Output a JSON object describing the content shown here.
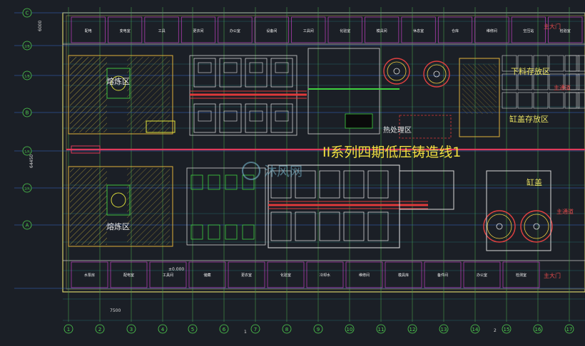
{
  "drawing": {
    "title": "II系列四期低压铸造线1",
    "watermark": "沐风网",
    "zones": {
      "melt_upper": "熔炼区",
      "melt_lower": "熔炼区",
      "heat_treat": "热处理区",
      "lower_material": "下料存放区",
      "cylinder_storage": "缸盖存放区",
      "cylinder_head": "缸盖"
    },
    "doors": {
      "main_top": "主大门",
      "main_bottom": "主大门",
      "main_channel_1": "主通道",
      "main_channel_2": "主通道"
    },
    "columns": [
      "1",
      "2",
      "3",
      "4",
      "5",
      "6",
      "7",
      "8",
      "9",
      "10",
      "11",
      "12",
      "13",
      "14",
      "15",
      "16",
      "17"
    ],
    "rows": [
      "C",
      "2/B",
      "1/B",
      "B",
      "1/A",
      "2/A",
      "A"
    ],
    "dims": {
      "bay": "7500",
      "row_span": "6000",
      "span_b": "64450",
      "elev": "±0.000",
      "col_1_label": "1",
      "col_2_label": "2"
    },
    "top_rooms": [
      "配电",
      "变电室",
      "工具",
      "更衣间",
      "办公室",
      "设备间",
      "工具间",
      "化验室",
      "模具间",
      "休息室",
      "仓库",
      "维修间",
      "空压站",
      "检验室"
    ],
    "bottom_rooms": [
      "水泵房",
      "配电室",
      "工具间",
      "储藏",
      "更衣室",
      "化验室",
      "冷却水",
      "维修间",
      "模具库",
      "备件间",
      "办公室",
      "检测室"
    ]
  }
}
